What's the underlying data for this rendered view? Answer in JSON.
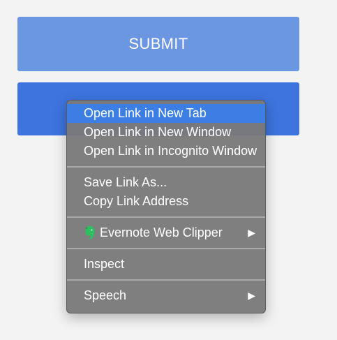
{
  "form": {
    "submit_label": "SUBMIT",
    "second_button_label": ""
  },
  "context_menu": {
    "groups": [
      [
        {
          "label": "Open Link in New Tab",
          "highlighted": true
        },
        {
          "label": "Open Link in New Window"
        },
        {
          "label": "Open Link in Incognito Window"
        }
      ],
      [
        {
          "label": "Save Link As..."
        },
        {
          "label": "Copy Link Address"
        }
      ],
      [
        {
          "label": "Evernote Web Clipper",
          "icon": "evernote-icon",
          "submenu": true
        }
      ],
      [
        {
          "label": "Inspect"
        }
      ],
      [
        {
          "label": "Speech",
          "submenu": true
        }
      ]
    ],
    "submenu_arrow_glyph": "▶"
  },
  "colors": {
    "page_background": "#f3f3f3",
    "submit_button": "#6b96e2",
    "second_button": "#3d74de",
    "menu_background": "#7a7a7a",
    "menu_highlight": "#3c7ee4",
    "evernote_green": "#2dbe60"
  }
}
